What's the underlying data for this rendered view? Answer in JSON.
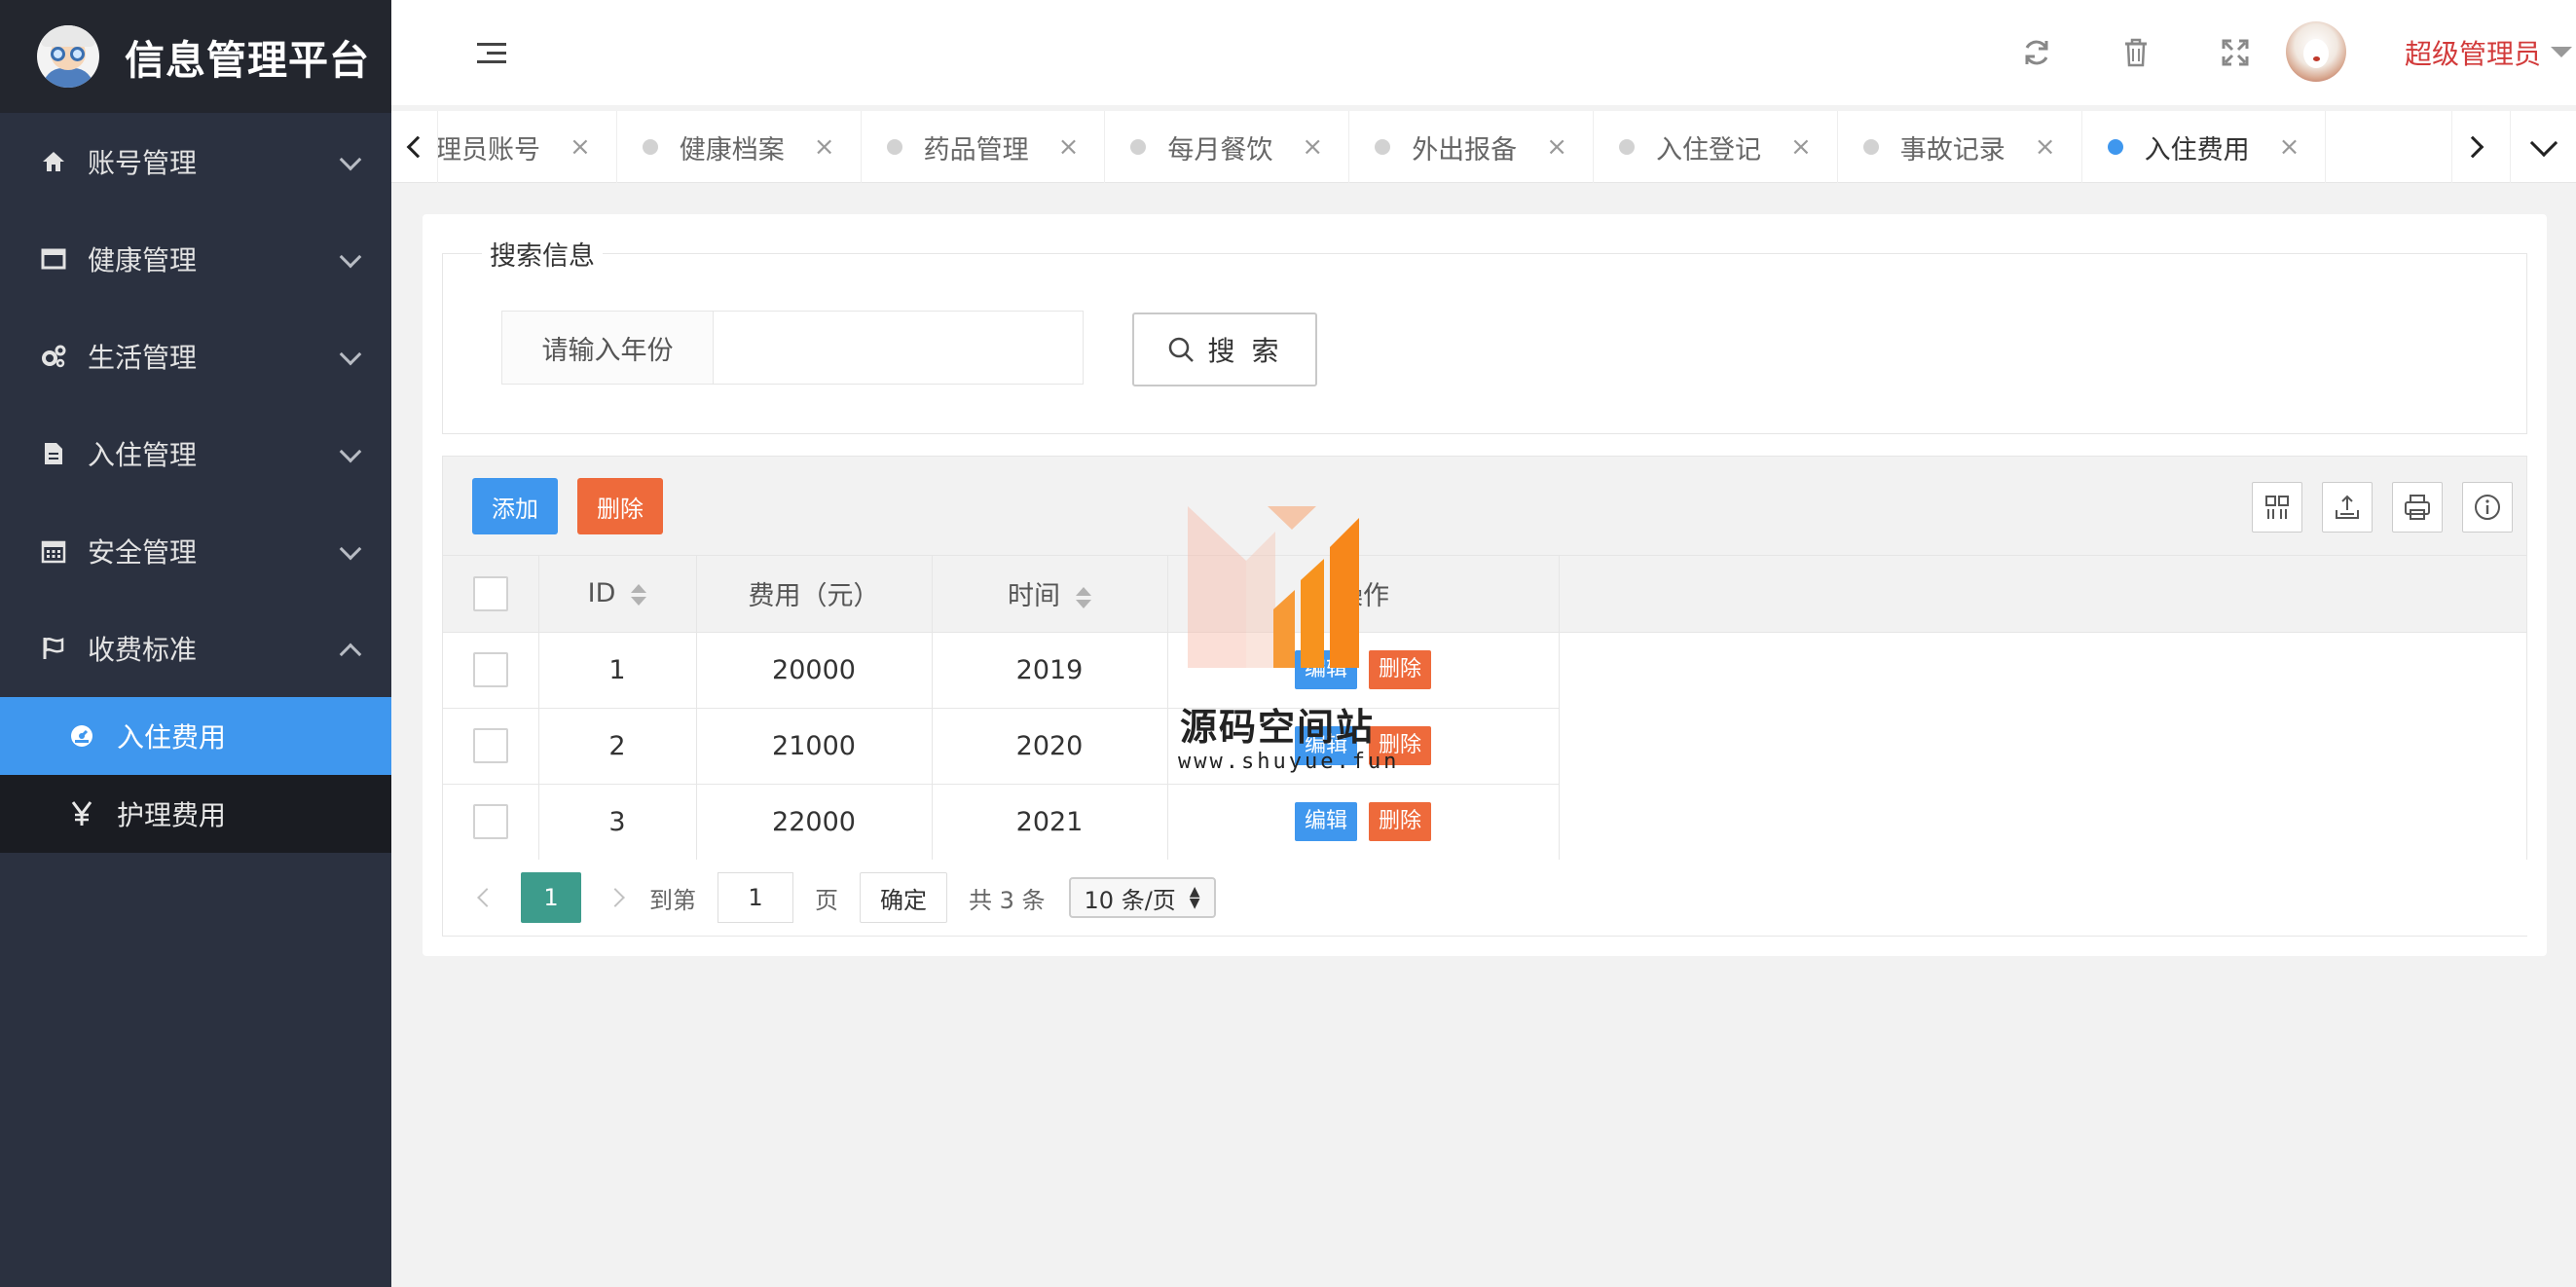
{
  "app": {
    "title": "信息管理平台"
  },
  "sidebar": {
    "items": [
      {
        "label": "账号管理",
        "icon": "home-icon"
      },
      {
        "label": "健康管理",
        "icon": "window-icon"
      },
      {
        "label": "生活管理",
        "icon": "gears-icon"
      },
      {
        "label": "入住管理",
        "icon": "file-icon"
      },
      {
        "label": "安全管理",
        "icon": "calendar-icon"
      },
      {
        "label": "收费标准",
        "icon": "flag-icon",
        "expanded": true
      }
    ],
    "subitems": [
      {
        "label": "入住费用",
        "icon": "dashboard-icon",
        "active": true
      },
      {
        "label": "护理费用",
        "icon": "yen-icon"
      }
    ]
  },
  "header": {
    "user_name": "超级管理员",
    "icons": [
      "refresh-icon",
      "trash-icon",
      "fullscreen-icon"
    ]
  },
  "tabs": [
    {
      "label": "管理员账号",
      "close": "×"
    },
    {
      "label": "健康档案",
      "close": "×"
    },
    {
      "label": "药品管理",
      "close": "×"
    },
    {
      "label": "每月餐饮",
      "close": "×"
    },
    {
      "label": "外出报备",
      "close": "×"
    },
    {
      "label": "入住登记",
      "close": "×"
    },
    {
      "label": "事故记录",
      "close": "×"
    },
    {
      "label": "入住费用",
      "close": "×",
      "active": true
    }
  ],
  "search": {
    "legend": "搜索信息",
    "label": "请输入年份",
    "value": "",
    "button": "搜 索"
  },
  "toolbar": {
    "add": "添加",
    "delete": "删除"
  },
  "table": {
    "columns": [
      "ID",
      "费用（元）",
      "时间",
      "操作"
    ],
    "rows": [
      {
        "id": "1",
        "fee": "20000",
        "year": "2019"
      },
      {
        "id": "2",
        "fee": "21000",
        "year": "2020"
      },
      {
        "id": "3",
        "fee": "22000",
        "year": "2021"
      }
    ],
    "edit_label": "编辑",
    "delete_label": "删除"
  },
  "pager": {
    "current": "1",
    "goto_prefix": "到第",
    "goto_value": "1",
    "page_suffix": "页",
    "confirm": "确定",
    "total": "共 3 条",
    "page_size": "10 条/页"
  },
  "watermark": {
    "text": "源码空间站",
    "url": "www.shuyue.fun"
  },
  "colors": {
    "primary": "#3f97ee",
    "danger": "#ee6a3b",
    "sidebar": "#2b3140",
    "pager_active": "#3d9c8c",
    "user": "#d23a3a"
  }
}
